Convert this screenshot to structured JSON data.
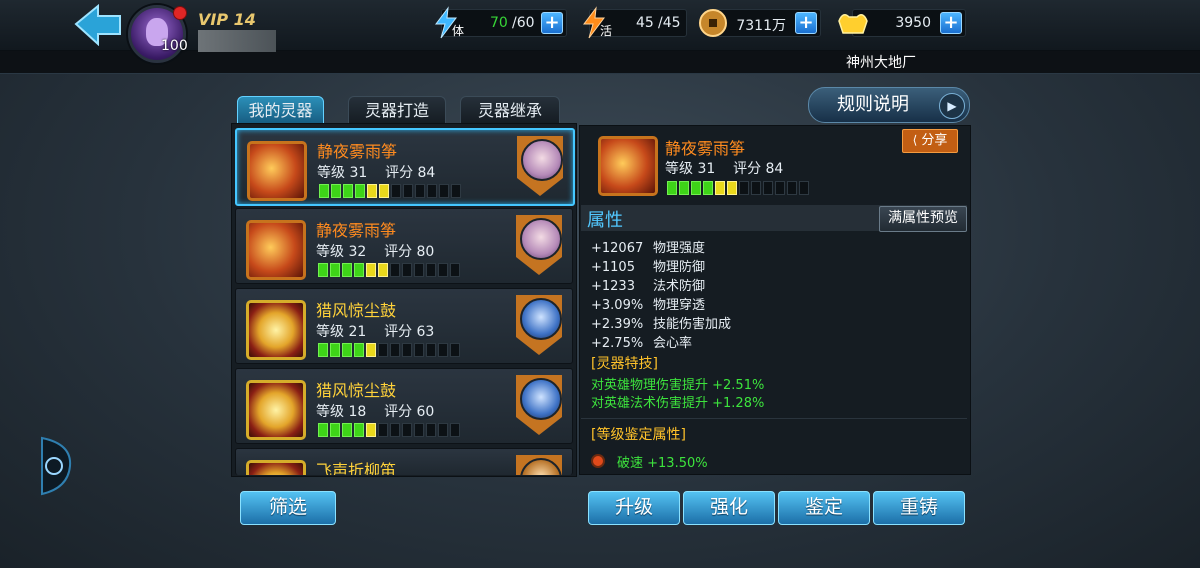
{
  "header": {
    "level": "100",
    "vip": "VIP 14",
    "stamina": {
      "label": "体",
      "value": "70",
      "max": "/60"
    },
    "vitality": {
      "label": "活",
      "value": "45",
      "max": "/45"
    },
    "coins": "7311万",
    "gold": "3950",
    "server": "神州大地厂"
  },
  "tabs": [
    "我的灵器",
    "灵器打造",
    "灵器继承"
  ],
  "rules_label": "规则说明",
  "items": [
    {
      "name": "静夜雾雨筝",
      "stats": "等级 31    评分 84",
      "rarity": "orange",
      "bars": [
        "g",
        "g",
        "g",
        "g",
        "y",
        "y",
        "e",
        "e",
        "e",
        "e",
        "e",
        "e"
      ]
    },
    {
      "name": "静夜雾雨筝",
      "stats": "等级 32    评分 80",
      "rarity": "orange",
      "bars": [
        "g",
        "g",
        "g",
        "g",
        "y",
        "y",
        "e",
        "e",
        "e",
        "e",
        "e",
        "e"
      ]
    },
    {
      "name": "猎风惊尘鼓",
      "stats": "等级 21    评分 63",
      "rarity": "gold",
      "bars": [
        "g",
        "g",
        "g",
        "g",
        "y",
        "e",
        "e",
        "e",
        "e",
        "e",
        "e",
        "e"
      ]
    },
    {
      "name": "猎风惊尘鼓",
      "stats": "等级 18    评分 60",
      "rarity": "gold",
      "bars": [
        "g",
        "g",
        "g",
        "g",
        "y",
        "e",
        "e",
        "e",
        "e",
        "e",
        "e",
        "e"
      ]
    },
    {
      "name": "飞声折柳笛",
      "stats": "",
      "rarity": "gold",
      "bars": []
    }
  ],
  "filter_label": "筛选",
  "detail": {
    "name": "静夜雾雨筝",
    "stats": "等级 31    评分 84",
    "share": "分享",
    "section_title": "属性",
    "preview_label": "满属性预览",
    "attributes": [
      {
        "value": "+12067",
        "name": "物理强度"
      },
      {
        "value": "+1105",
        "name": "物理防御"
      },
      {
        "value": "+1233",
        "name": "法术防御"
      },
      {
        "value": "+3.09%",
        "name": "物理穿透"
      },
      {
        "value": "+2.39%",
        "name": "技能伤害加成"
      },
      {
        "value": "+2.75%",
        "name": "会心率"
      }
    ],
    "skill_title": "[灵器特技]",
    "skills": [
      "对英雄物理伤害提升 +2.51%",
      "对英雄法术伤害提升 +1.28%"
    ],
    "appraise_title": "[等级鉴定属性]",
    "appraise": "破速 +13.50%"
  },
  "actions": [
    "升级",
    "强化",
    "鉴定",
    "重铸"
  ]
}
